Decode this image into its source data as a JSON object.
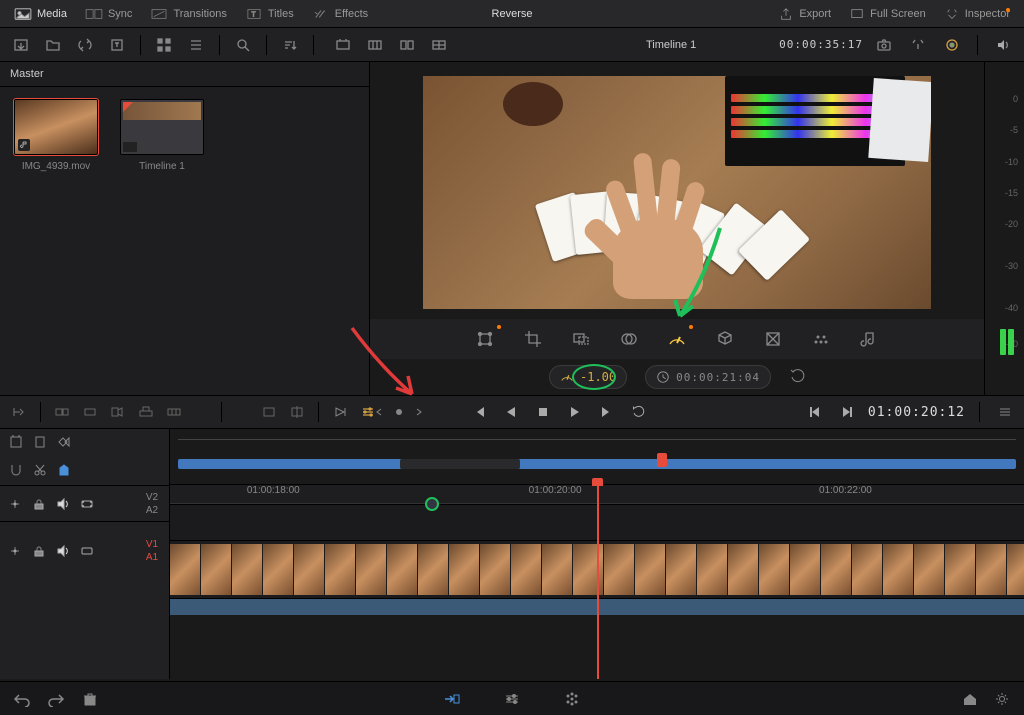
{
  "top_menu": {
    "media": "Media",
    "sync": "Sync",
    "transitions": "Transitions",
    "titles": "Titles",
    "effects": "Effects",
    "center": "Reverse",
    "export": "Export",
    "fullscreen": "Full Screen",
    "inspector": "Inspector"
  },
  "toolbar2": {
    "timeline_name": "Timeline 1",
    "timecode": "00:00:35:17"
  },
  "media_pool": {
    "header": "Master",
    "items": [
      {
        "label": "IMG_4939.mov"
      },
      {
        "label": "Timeline 1"
      }
    ]
  },
  "retime": {
    "speed_value": "-1.00",
    "clock_tc": "00:00:21:04"
  },
  "transport": {
    "timecode": "01:00:20:12"
  },
  "timeline": {
    "ticks": [
      "01:00:18:00",
      "01:00:20:00",
      "01:00:22:00"
    ],
    "tracks": {
      "v2": "V2",
      "a2": "A2",
      "v1": "V1",
      "a1": "A1"
    }
  },
  "meter": {
    "ticks": [
      "0",
      "-5",
      "-10",
      "-15",
      "-20",
      "-30",
      "-40",
      "-50"
    ]
  }
}
